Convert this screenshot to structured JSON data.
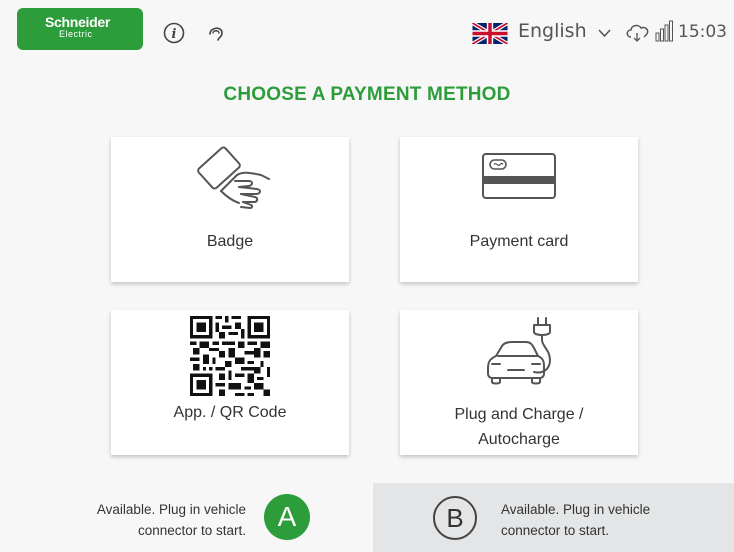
{
  "header": {
    "brand_line1": "Schneider",
    "brand_line2": "Electric",
    "language": "English",
    "time": "15:03",
    "icons": [
      "info-icon",
      "support-icon",
      "uk-flag-icon",
      "chevron-down-icon",
      "cloud-icon",
      "signal-icon"
    ]
  },
  "title": "CHOOSE A PAYMENT METHOD",
  "methods": [
    {
      "label": "Badge",
      "icon": "badge-card-icon"
    },
    {
      "label": "Payment card",
      "icon": "credit-card-icon"
    },
    {
      "label": "App. / QR Code",
      "icon": "qr-code-icon"
    },
    {
      "label_line1": "Plug and Charge /",
      "label_line2": "Autocharge",
      "icon": "ev-plug-icon"
    }
  ],
  "connectors": [
    {
      "id": "A",
      "status_line1": "Available. Plug in vehicle",
      "status_line2": "connector to start."
    },
    {
      "id": "B",
      "status_line1": "Available. Plug in vehicle",
      "status_line2": "connector to start."
    }
  ],
  "colors": {
    "brand_green": "#2d9d3c",
    "panel_grey": "#e3e5e6"
  }
}
